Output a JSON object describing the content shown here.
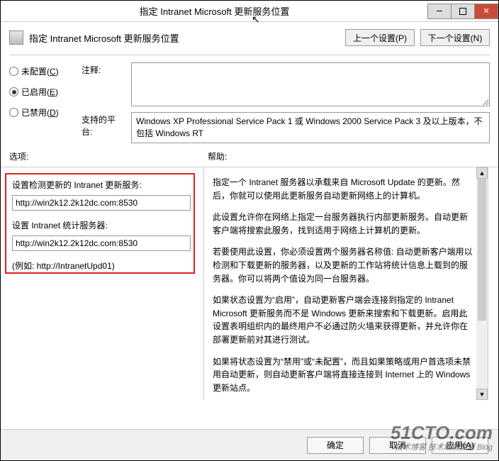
{
  "window": {
    "title": "指定 Intranet Microsoft 更新服务位置"
  },
  "header": {
    "title": "指定 Intranet Microsoft 更新服务位置",
    "prev": "上一个设置(P)",
    "next": "下一个设置(N)"
  },
  "radios": {
    "not_configured": "未配置(C)",
    "enabled": "已启用(E)",
    "disabled": "已禁用(D)"
  },
  "comment_label": "注释:",
  "platform_label": "支持的平台:",
  "platform_text": "Windows XP Professional Service Pack 1 或 Windows 2000 Service Pack 3 及以上版本，不包括 Windows RT",
  "options_label": "选项:",
  "help_label": "帮助:",
  "options": {
    "update_service_label": "设置检测更新的 Intranet 更新服务:",
    "update_service_value": "http://win2k12.2k12dc.com:8530",
    "stats_server_label": "设置 Intranet 统计服务器:",
    "stats_server_value": "http://win2k12.2k12dc.com:8530",
    "example": "(例如: http://IntranetUpd01)"
  },
  "help": {
    "p1": "指定一个 Intranet 服务器以承载来自 Microsoft Update 的更新。然后，你就可以使用此更新服务自动更新网络上的计算机。",
    "p2": "此设置允许你在网络上指定一台服务器执行内部更新服务。自动更新客户端将搜索此服务，找到适用于网络上计算机的更新。",
    "p3": "若要使用此设置，你必须设置两个服务器名称值: 自动更新客户端用以检测和下载更新的服务器，以及更新的工作站将统计信息上载到的服务器。你可以将两个值设为同一台服务器。",
    "p4": "如果状态设置为“启用”，自动更新客户端会连接到指定的 Intranet Microsoft 更新服务而不是 Windows 更新来搜索和下载更新。启用此设置表明组织内的最终用户不必通过防火墙来获得更新，并允许你在部署更新前对其进行测试。",
    "p5": "如果将状态设置为“禁用”或“未配置”，而且如果策略或用户首选项未禁用自动更新，则自动更新客户端将直接连接到 Internet 上的 Windows 更新站点。"
  },
  "footer": {
    "ok": "确定",
    "cancel": "取消",
    "apply": "应用(A)"
  },
  "watermark": {
    "big": "51CTO.com",
    "sub": "技术博客",
    "tag": "技术成就梦想 Blog"
  }
}
